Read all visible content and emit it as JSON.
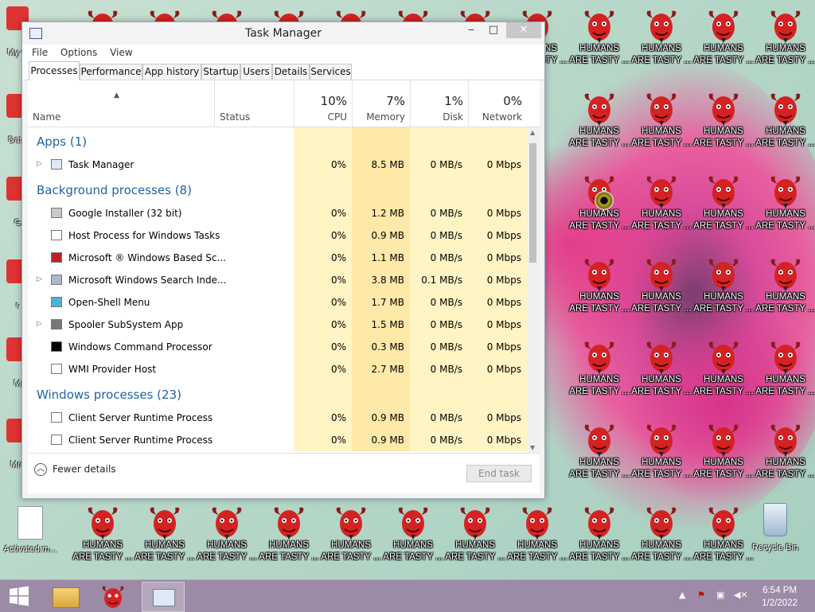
{
  "desktop": {
    "demon_label": "HUMANS ARE TASTY ...",
    "demon_label_line1": "HUMANS",
    "demon_label_line2": "ARE TASTY ...",
    "icons": [
      {
        "label": "My C",
        "icon": "computer-icon"
      },
      {
        "label": "Data",
        "icon": "data-icon"
      },
      {
        "label": "G",
        "icon": "app-icon"
      },
      {
        "label": "r",
        "icon": "app-icon"
      },
      {
        "label": "M",
        "icon": "app-icon"
      },
      {
        "label": "Mrs",
        "icon": "app-icon"
      },
      {
        "label": "Activated.m...",
        "icon": "document-icon"
      },
      {
        "label": "Recycle Bin",
        "icon": "recycle-bin-icon"
      }
    ]
  },
  "window": {
    "title": "Task Manager",
    "minimize": "‒",
    "maximize": "□",
    "close": "✕"
  },
  "menu": [
    "File",
    "Options",
    "View"
  ],
  "tabs": [
    "Processes",
    "Performance",
    "App history",
    "Startup",
    "Users",
    "Details",
    "Services"
  ],
  "active_tab": "Processes",
  "columns": {
    "name": "Name",
    "status": "Status",
    "cpu": {
      "pct": "10%",
      "label": "CPU"
    },
    "memory": {
      "pct": "7%",
      "label": "Memory"
    },
    "disk": {
      "pct": "1%",
      "label": "Disk"
    },
    "network": {
      "pct": "0%",
      "label": "Network"
    }
  },
  "groups": [
    {
      "title": "Apps (1)",
      "rows": [
        {
          "name": "Task Manager",
          "expand": true,
          "icon": "task-manager-icon",
          "cpu": "0%",
          "mem": "8.5 MB",
          "disk": "0 MB/s",
          "net": "0 Mbps"
        }
      ]
    },
    {
      "title": "Background processes (8)",
      "rows": [
        {
          "name": "Google Installer (32 bit)",
          "expand": false,
          "icon": "installer-icon",
          "cpu": "0%",
          "mem": "1.2 MB",
          "disk": "0 MB/s",
          "net": "0 Mbps"
        },
        {
          "name": "Host Process for Windows Tasks",
          "expand": false,
          "icon": "window-icon",
          "cpu": "0%",
          "mem": "0.9 MB",
          "disk": "0 MB/s",
          "net": "0 Mbps"
        },
        {
          "name": "Microsoft ® Windows Based Sc...",
          "expand": false,
          "icon": "script-icon",
          "cpu": "0%",
          "mem": "1.1 MB",
          "disk": "0 MB/s",
          "net": "0 Mbps"
        },
        {
          "name": "Microsoft Windows Search Inde...",
          "expand": true,
          "icon": "search-person-icon",
          "cpu": "0%",
          "mem": "3.8 MB",
          "disk": "0.1 MB/s",
          "net": "0 Mbps"
        },
        {
          "name": "Open-Shell Menu",
          "expand": false,
          "icon": "shell-icon",
          "cpu": "0%",
          "mem": "1.7 MB",
          "disk": "0 MB/s",
          "net": "0 Mbps"
        },
        {
          "name": "Spooler SubSystem App",
          "expand": true,
          "icon": "printer-icon",
          "cpu": "0%",
          "mem": "1.5 MB",
          "disk": "0 MB/s",
          "net": "0 Mbps"
        },
        {
          "name": "Windows Command Processor",
          "expand": false,
          "icon": "cmd-icon",
          "cpu": "0%",
          "mem": "0.3 MB",
          "disk": "0 MB/s",
          "net": "0 Mbps"
        },
        {
          "name": "WMI Provider Host",
          "expand": false,
          "icon": "window-icon",
          "cpu": "0%",
          "mem": "2.7 MB",
          "disk": "0 MB/s",
          "net": "0 Mbps"
        }
      ]
    },
    {
      "title": "Windows processes (23)",
      "rows": [
        {
          "name": "Client Server Runtime Process",
          "expand": false,
          "icon": "window-icon",
          "cpu": "0%",
          "mem": "0.9 MB",
          "disk": "0 MB/s",
          "net": "0 Mbps"
        },
        {
          "name": "Client Server Runtime Process",
          "expand": false,
          "icon": "window-icon",
          "cpu": "0%",
          "mem": "0.9 MB",
          "disk": "0 MB/s",
          "net": "0 Mbps"
        }
      ]
    }
  ],
  "footer": {
    "fewer_details": "Fewer details",
    "end_task": "End task"
  },
  "taskbar": {
    "time": "6:54 PM",
    "date": "1/2/2022",
    "items": [
      "start-icon",
      "file-explorer-icon",
      "demon-app-icon",
      "task-manager-icon"
    ]
  },
  "colors": {
    "accent_link": "#1e63a6",
    "cpu_column": "#fff4c4",
    "memory_column": "#ffe9a8",
    "taskbar": "#9d8aa6"
  }
}
